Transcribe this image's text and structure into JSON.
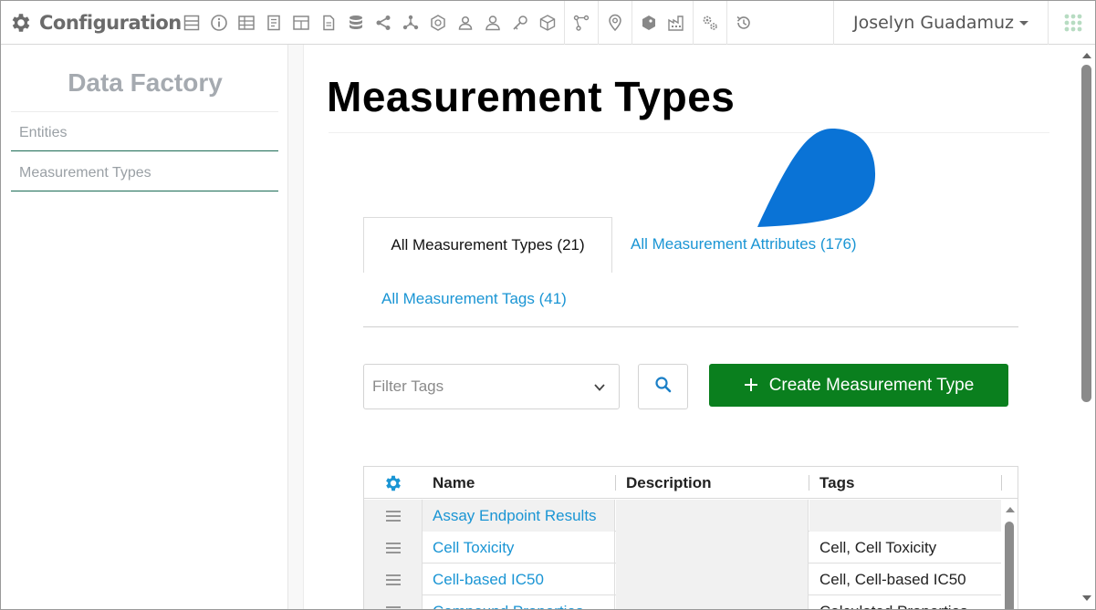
{
  "app": {
    "title": "Configuration",
    "user_name": "Joselyn Guadamuz"
  },
  "toolbar_icons": [
    "layout-icon",
    "info-icon",
    "table-icon",
    "book-icon",
    "grid-icon",
    "document-icon",
    "database-icon",
    "share-icon",
    "network-icon",
    "compound-icon",
    "user-group-icon",
    "user-icon",
    "key-icon",
    "cube-icon",
    "pipeline-icon",
    "location-pin-icon",
    "tag-icon",
    "factory-icon",
    "settings-cogs-icon",
    "history-icon"
  ],
  "sidebar": {
    "title": "Data Factory",
    "items": [
      {
        "label": "Entities"
      },
      {
        "label": "Measurement Types"
      }
    ]
  },
  "main": {
    "title": "Measurement Types",
    "tabs": [
      {
        "label": "All Measurement Types (21)",
        "active": true
      },
      {
        "label": "All Measurement Attributes (176)",
        "active": false
      },
      {
        "label": "All Measurement Tags (41)",
        "active": false
      }
    ],
    "filter": {
      "placeholder": "Filter Tags"
    },
    "create_button": {
      "label": "Create Measurement Type"
    },
    "grid": {
      "columns": [
        "Name",
        "Description",
        "Tags"
      ],
      "rows": [
        {
          "name": "Assay Endpoint Results",
          "description": "",
          "tags": ""
        },
        {
          "name": "Cell Toxicity",
          "description": "",
          "tags": "Cell, Cell Toxicity"
        },
        {
          "name": "Cell-based IC50",
          "description": "",
          "tags": "Cell, Cell-based IC50"
        },
        {
          "name": "Compound Properties",
          "description": "",
          "tags": "Calculated Properties"
        }
      ]
    }
  },
  "colors": {
    "accent_link": "#1a95d4",
    "create_button": "#0a7f1e",
    "sidebar_active_rule": "#1b6b55",
    "annotation_drop": "#0a73d6"
  }
}
